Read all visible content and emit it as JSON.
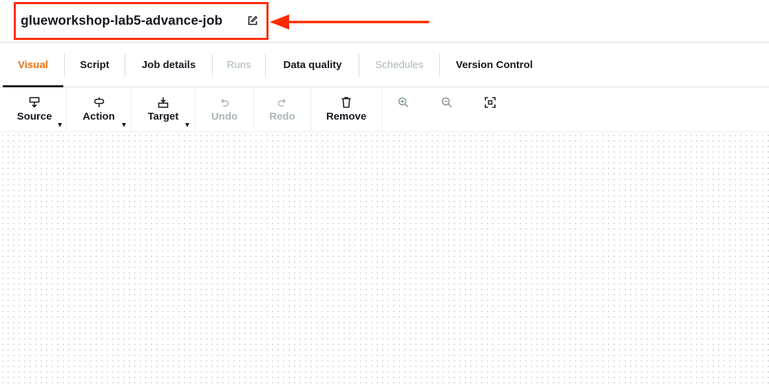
{
  "job": {
    "name": "glueworkshop-lab5-advance-job",
    "edit_icon": "edit-icon",
    "highlight_color": "#ff2a00"
  },
  "tabs": [
    {
      "label": "Visual",
      "state": "active"
    },
    {
      "label": "Script",
      "state": "enabled"
    },
    {
      "label": "Job details",
      "state": "enabled"
    },
    {
      "label": "Runs",
      "state": "disabled"
    },
    {
      "label": "Data quality",
      "state": "enabled"
    },
    {
      "label": "Schedules",
      "state": "disabled"
    },
    {
      "label": "Version Control",
      "state": "enabled"
    }
  ],
  "toolbar": {
    "source": {
      "label": "Source",
      "icon": "source-node-icon"
    },
    "action": {
      "label": "Action",
      "icon": "transform-node-icon"
    },
    "target": {
      "label": "Target",
      "icon": "target-node-icon"
    },
    "undo": {
      "label": "Undo",
      "icon": "undo-icon",
      "state": "disabled"
    },
    "redo": {
      "label": "Redo",
      "icon": "redo-icon",
      "state": "disabled"
    },
    "remove": {
      "label": "Remove",
      "icon": "trash-icon"
    },
    "zoom_in": {
      "icon": "zoom-in-icon"
    },
    "zoom_out": {
      "icon": "zoom-out-icon"
    },
    "fit": {
      "icon": "fit-to-screen-icon"
    }
  },
  "colors": {
    "active_tab": "#ec7211",
    "disabled": "#aab7b8",
    "text": "#16191f"
  }
}
